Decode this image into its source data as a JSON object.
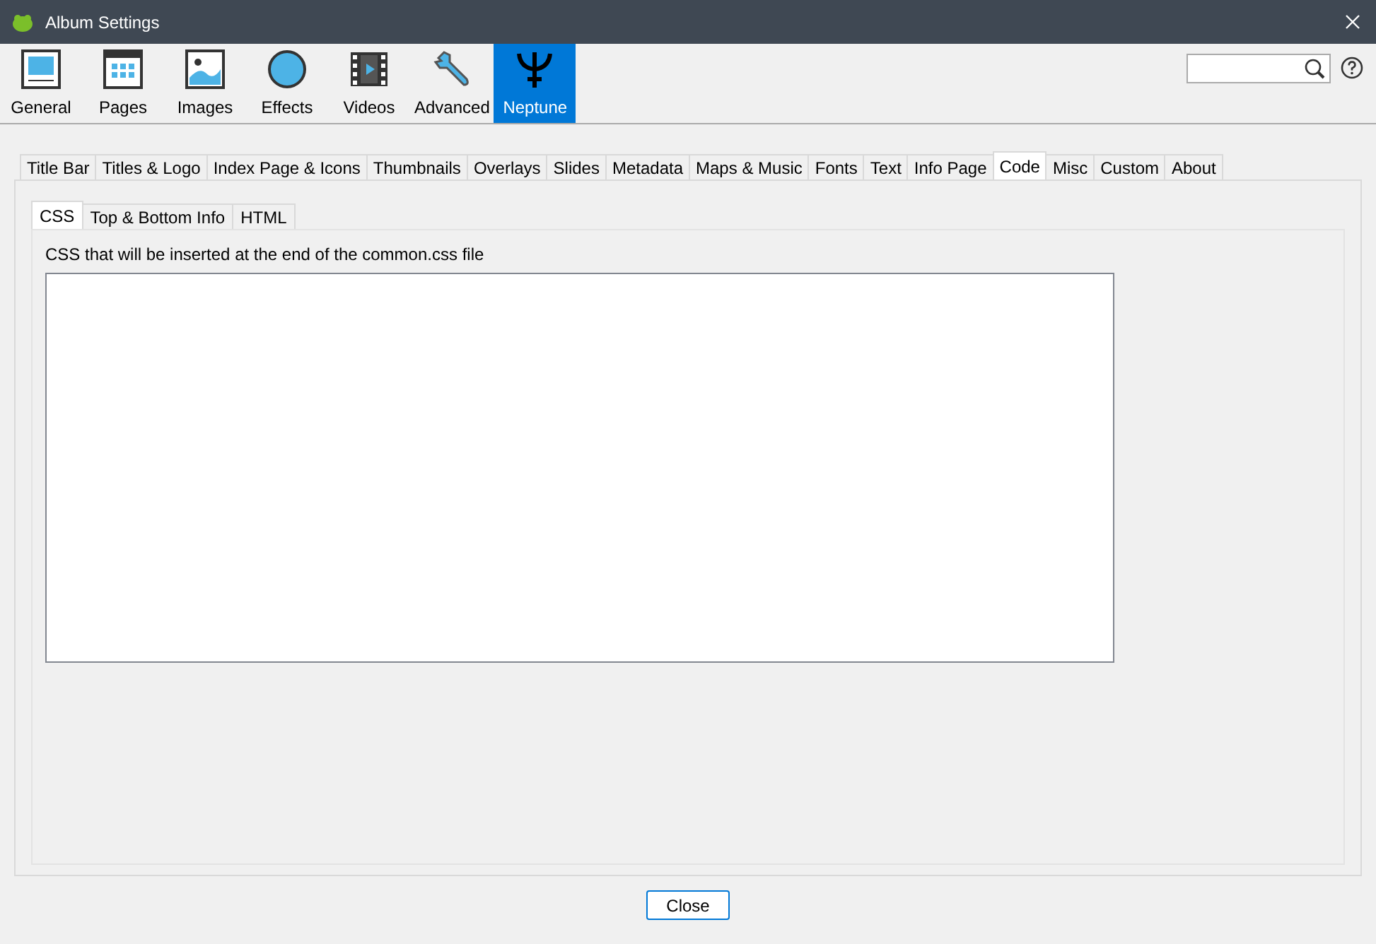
{
  "window": {
    "title": "Album Settings"
  },
  "toolbar": [
    {
      "label": "General",
      "kind": "general",
      "selected": false
    },
    {
      "label": "Pages",
      "kind": "pages",
      "selected": false
    },
    {
      "label": "Images",
      "kind": "images",
      "selected": false
    },
    {
      "label": "Effects",
      "kind": "effects",
      "selected": false
    },
    {
      "label": "Videos",
      "kind": "videos",
      "selected": false
    },
    {
      "label": "Advanced",
      "kind": "advanced",
      "selected": false
    },
    {
      "label": "Neptune",
      "kind": "neptune",
      "selected": true
    }
  ],
  "tabs": [
    {
      "label": "Title Bar",
      "selected": false
    },
    {
      "label": "Titles & Logo",
      "selected": false
    },
    {
      "label": "Index Page & Icons",
      "selected": false
    },
    {
      "label": "Thumbnails",
      "selected": false
    },
    {
      "label": "Overlays",
      "selected": false
    },
    {
      "label": "Slides",
      "selected": false
    },
    {
      "label": "Metadata",
      "selected": false
    },
    {
      "label": "Maps & Music",
      "selected": false
    },
    {
      "label": "Fonts",
      "selected": false
    },
    {
      "label": "Text",
      "selected": false
    },
    {
      "label": "Info Page",
      "selected": false
    },
    {
      "label": "Code",
      "selected": true
    },
    {
      "label": "Misc",
      "selected": false
    },
    {
      "label": "Custom",
      "selected": false
    },
    {
      "label": "About",
      "selected": false
    }
  ],
  "subtabs": [
    {
      "label": "CSS",
      "selected": true
    },
    {
      "label": "Top & Bottom Info",
      "selected": false
    },
    {
      "label": "HTML",
      "selected": false
    }
  ],
  "css_label": "CSS that will be inserted at the end of the common.css file",
  "close_button": "Close"
}
